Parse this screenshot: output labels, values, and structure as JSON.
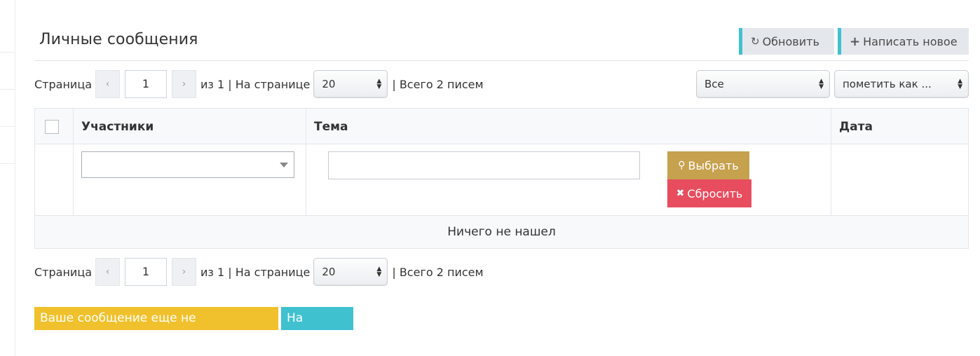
{
  "page_title": "Личные сообщения",
  "toolbar": {
    "refresh_label": "Обновить",
    "write_label": "Написать новое"
  },
  "pager": {
    "page_label": "Страница",
    "prev_icon": "‹",
    "next_icon": "›",
    "page_value": "1",
    "of_text": "из 1 | На странице",
    "per_page_value": "20",
    "total_text": "| Всего 2 писем"
  },
  "filters": {
    "status_value": "Все",
    "mark_value": "пометить как ..."
  },
  "table": {
    "columns": [
      "Участники",
      "Тема",
      "Дата"
    ],
    "participants_value": "",
    "subject_value": "",
    "select_button": "Выбрать",
    "reset_button": "Сбросить",
    "empty_text": "Ничего не нашел"
  },
  "labels": {
    "unread_notice": "Ваше сообщение еще не прочитанно",
    "site_link": "На AQA.ru"
  },
  "colors": {
    "accent_teal": "#3fc1cf",
    "button_gold": "#c6a14e",
    "button_red": "#e74d5f",
    "label_yellow": "#f0c12c"
  },
  "icons": {
    "refresh": "refresh-icon",
    "plus": "plus-icon",
    "search": "search-icon",
    "close": "close-icon"
  }
}
